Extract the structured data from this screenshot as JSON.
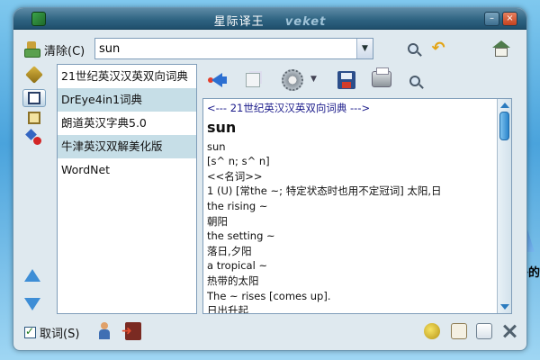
{
  "window": {
    "title": "星际译王",
    "brand": "veket"
  },
  "search": {
    "clear_label": "清除(C)",
    "value": "sun"
  },
  "dictionaries": [
    {
      "label": "21世纪英汉汉英双向词典",
      "selected": false
    },
    {
      "label": "DrEye4in1词典",
      "selected": true
    },
    {
      "label": "朗道英汉字典5.0",
      "selected": false
    },
    {
      "label": "牛津英汉双解美化版",
      "selected": true
    },
    {
      "label": "WordNet",
      "selected": false
    }
  ],
  "definition": {
    "header": "<--- 21世纪英汉汉英双向词典 --->",
    "word": "sun",
    "lines": [
      "sun",
      "[s^ n; s^ n]",
      "<<名词>>",
      "1 (U) [常the ~; 特定状态时也用不定冠词] 太阳,日",
      "the rising ~",
      "朝阳",
      "the setting ~",
      "落日,夕阳",
      "a tropical ~",
      "热带的太阳",
      "The ~ rises [comes up].",
      "日出升起"
    ]
  },
  "bottom": {
    "fetch_label": "取词(S)"
  },
  "desktop": {
    "text": "子的"
  },
  "colors": {
    "titlebar": "#2f6482",
    "selection": "#c6dee7",
    "accent": "#2a84cb"
  },
  "icons": {
    "app": "app-icon",
    "clear": "clear-icon",
    "search": "search-icon",
    "back": "back-arrow-icon",
    "home": "home-icon",
    "speak": "speaker-icon",
    "copy": "copy-icon",
    "settings": "gear-icon",
    "save": "save-icon",
    "print": "printer-icon",
    "find": "find-icon"
  }
}
